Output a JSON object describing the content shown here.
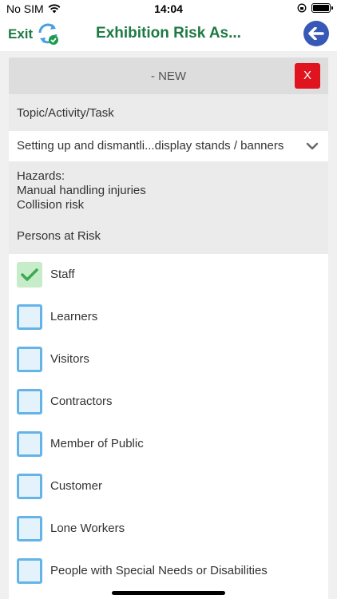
{
  "status_bar": {
    "carrier": "No SIM",
    "time": "14:04"
  },
  "nav": {
    "exit_label": "Exit",
    "title": "Exhibition Risk As..."
  },
  "card": {
    "title": "- NEW",
    "close_label": "X",
    "topic_label": "Topic/Activity/Task",
    "topic_value": "Setting up and dismantli...display stands / banners",
    "hazards_heading": "Hazards:",
    "hazards": [
      "Manual handling injuries",
      "Collision risk"
    ],
    "persons_label": "Persons at Risk",
    "persons": [
      {
        "label": "Staff",
        "checked": true
      },
      {
        "label": "Learners",
        "checked": false
      },
      {
        "label": "Visitors",
        "checked": false
      },
      {
        "label": "Contractors",
        "checked": false
      },
      {
        "label": "Member of Public",
        "checked": false
      },
      {
        "label": "Customer",
        "checked": false
      },
      {
        "label": "Lone Workers",
        "checked": false
      },
      {
        "label": "People with Special Needs or Disabilities",
        "checked": false
      }
    ]
  },
  "colors": {
    "brand_green": "#1d7a43",
    "back_button_blue": "#3858b8",
    "close_red": "#e0141e",
    "checkbox_border": "#65b4e8",
    "checkbox_checked_bg": "#c7ecca",
    "check_mark": "#3daa4f"
  }
}
